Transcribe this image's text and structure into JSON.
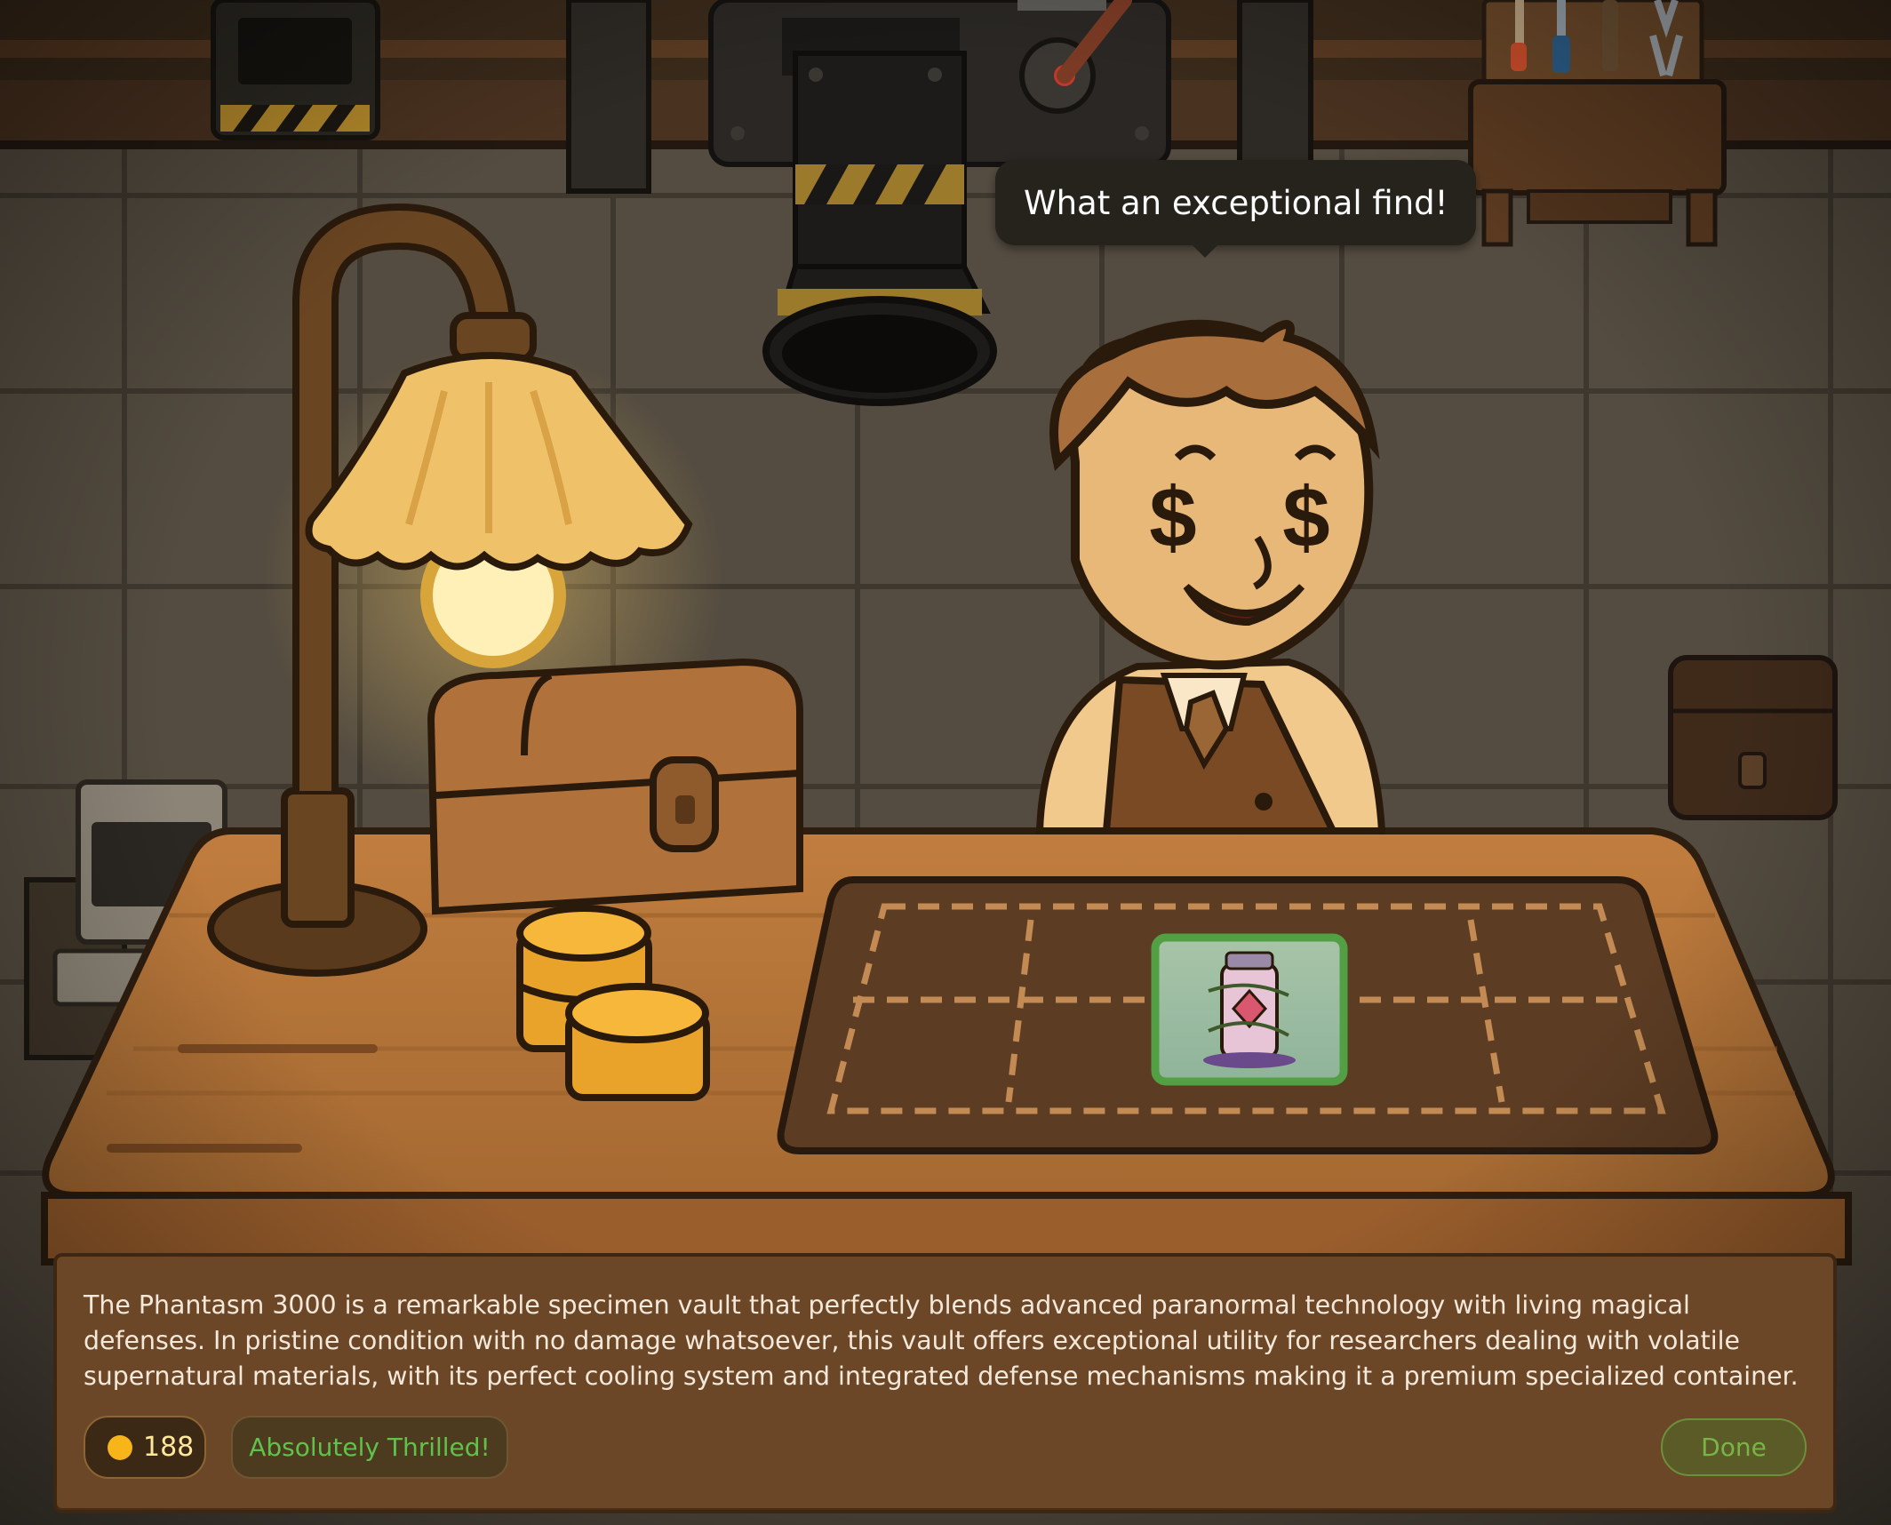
{
  "speech_bubble": {
    "text": "What an exceptional find!"
  },
  "dialog": {
    "description": "The Phantasm 3000 is a remarkable specimen vault that perfectly blends advanced paranormal technology with living magical defenses. In pristine condition with no damage whatsoever, this vault offers exceptional utility for researchers dealing with volatile supernatural materials, with its perfect cooling system and integrated defense mechanisms making it a premium specialized container.",
    "coins": "188",
    "mood": "Absolutely Thrilled!",
    "done_label": "Done"
  },
  "colors": {
    "coin": "#f7b519",
    "mood_text": "#5fc24a",
    "done_text": "#78b547",
    "panel_bg": "#6b4727"
  },
  "icons": [
    "coin-icon",
    "dollar-eyes",
    "pull-lever-icon"
  ]
}
